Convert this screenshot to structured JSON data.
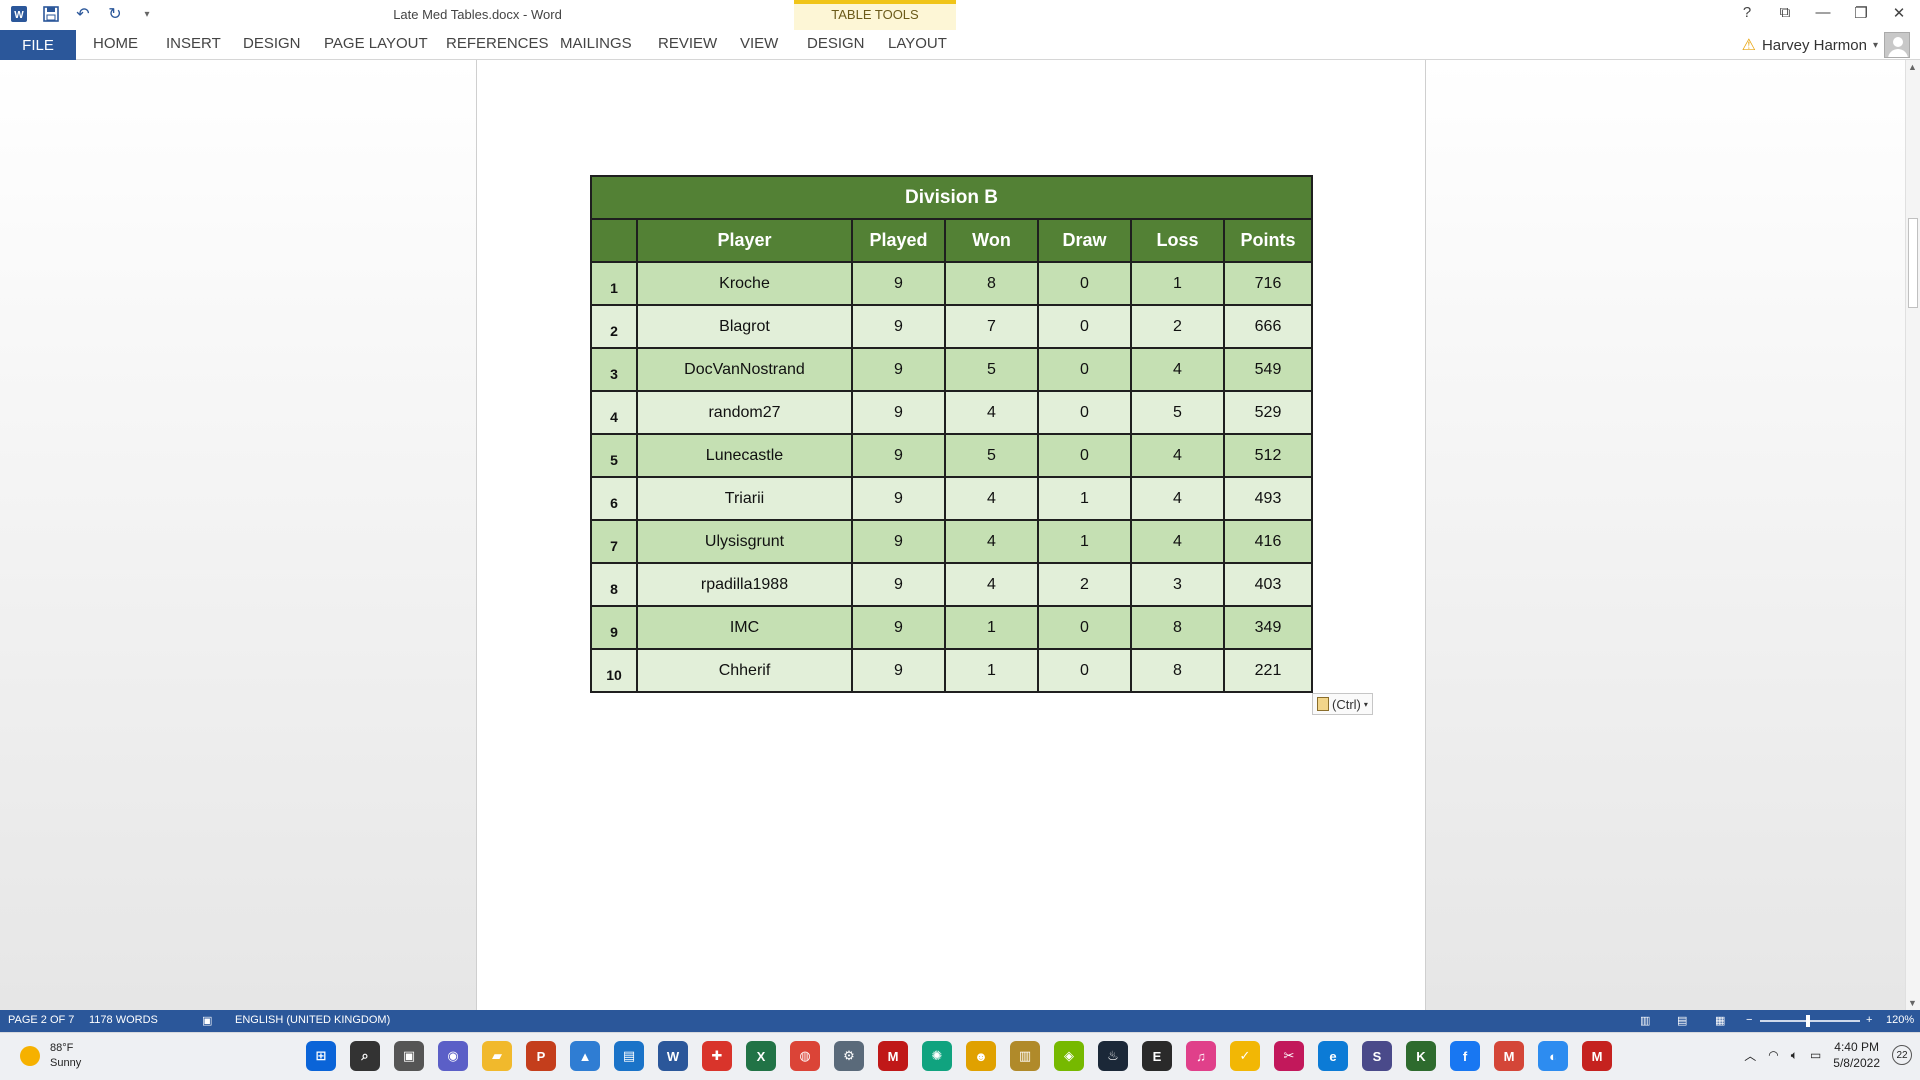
{
  "window": {
    "title": "Late Med Tables.docx - Word",
    "contextual_group": "TABLE TOOLS",
    "controls": [
      "?",
      "⧉",
      "—",
      "❐",
      "✕"
    ]
  },
  "ribbon": {
    "file_label": "FILE",
    "tabs": [
      "HOME",
      "INSERT",
      "DESIGN",
      "PAGE LAYOUT",
      "REFERENCES",
      "MAILINGS",
      "REVIEW",
      "VIEW",
      "DESIGN",
      "LAYOUT"
    ],
    "user_name": "Harvey Harmon"
  },
  "table": {
    "caption": "Division B",
    "headers": [
      "Player",
      "Played",
      "Won",
      "Draw",
      "Loss",
      "Points"
    ],
    "rows": [
      {
        "rank": "1",
        "player": "Kroche",
        "played": "9",
        "won": "8",
        "draw": "0",
        "loss": "1",
        "points": "716"
      },
      {
        "rank": "2",
        "player": "Blagrot",
        "played": "9",
        "won": "7",
        "draw": "0",
        "loss": "2",
        "points": "666"
      },
      {
        "rank": "3",
        "player": "DocVanNostrand",
        "played": "9",
        "won": "5",
        "draw": "0",
        "loss": "4",
        "points": "549"
      },
      {
        "rank": "4",
        "player": "random27",
        "played": "9",
        "won": "4",
        "draw": "0",
        "loss": "5",
        "points": "529"
      },
      {
        "rank": "5",
        "player": "Lunecastle",
        "played": "9",
        "won": "5",
        "draw": "0",
        "loss": "4",
        "points": "512"
      },
      {
        "rank": "6",
        "player": "Triarii",
        "played": "9",
        "won": "4",
        "draw": "1",
        "loss": "4",
        "points": "493"
      },
      {
        "rank": "7",
        "player": "Ulysisgrunt",
        "played": "9",
        "won": "4",
        "draw": "1",
        "loss": "4",
        "points": "416"
      },
      {
        "rank": "8",
        "player": "rpadilla1988",
        "played": "9",
        "won": "4",
        "draw": "2",
        "loss": "3",
        "points": "403"
      },
      {
        "rank": "9",
        "player": "IMC",
        "played": "9",
        "won": "1",
        "draw": "0",
        "loss": "8",
        "points": "349"
      },
      {
        "rank": "10",
        "player": "Chherif",
        "played": "9",
        "won": "1",
        "draw": "0",
        "loss": "8",
        "points": "221"
      }
    ],
    "paste_options_label": "(Ctrl)"
  },
  "statusbar": {
    "page": "PAGE 2 OF 7",
    "words": "1178 WORDS",
    "language": "ENGLISH (UNITED KINGDOM)",
    "zoom": "120%",
    "zoom_minus": "−",
    "zoom_plus": "+"
  },
  "taskbar": {
    "weather_temp": "88°F",
    "weather_desc": "Sunny",
    "time": "4:40 PM",
    "date": "5/8/2022",
    "notifications": "22",
    "app_icons": [
      {
        "name": "start-icon",
        "glyph": "⊞",
        "color": "#0a64d8"
      },
      {
        "name": "search-icon",
        "glyph": "⌕",
        "color": "#333333"
      },
      {
        "name": "task-view-icon",
        "glyph": "▣",
        "color": "#555555"
      },
      {
        "name": "chat-icon",
        "glyph": "◉",
        "color": "#5b5fc7"
      },
      {
        "name": "file-explorer-icon",
        "glyph": "▰",
        "color": "#f1b92c"
      },
      {
        "name": "powerpoint-icon",
        "glyph": "P",
        "color": "#c43e1c"
      },
      {
        "name": "photos-icon",
        "glyph": "▲",
        "color": "#2f7dd3"
      },
      {
        "name": "store-icon",
        "glyph": "▤",
        "color": "#1a73c8"
      },
      {
        "name": "word-icon",
        "glyph": "W",
        "color": "#2b579a"
      },
      {
        "name": "gift-icon",
        "glyph": "✚",
        "color": "#d9342b"
      },
      {
        "name": "excel-icon",
        "glyph": "X",
        "color": "#217346"
      },
      {
        "name": "chrome-icon",
        "glyph": "◍",
        "color": "#db4437"
      },
      {
        "name": "settings-icon",
        "glyph": "⚙",
        "color": "#5a6a7a"
      },
      {
        "name": "mcafee-icon",
        "glyph": "M",
        "color": "#c01818"
      },
      {
        "name": "chatgpt-icon",
        "glyph": "✺",
        "color": "#10a37f"
      },
      {
        "name": "game-icon",
        "glyph": "☻",
        "color": "#e0a100"
      },
      {
        "name": "notes-icon",
        "glyph": "▥",
        "color": "#b08a2a"
      },
      {
        "name": "nvidia-icon",
        "glyph": "◈",
        "color": "#76b900"
      },
      {
        "name": "steam-icon",
        "glyph": "♨",
        "color": "#1b2838"
      },
      {
        "name": "epic-games-icon",
        "glyph": "E",
        "color": "#2a2a2a"
      },
      {
        "name": "itunes-icon",
        "glyph": "♫",
        "color": "#e0408a"
      },
      {
        "name": "norton-icon",
        "glyph": "✓",
        "color": "#f2b705"
      },
      {
        "name": "snip-icon",
        "glyph": "✂",
        "color": "#c2185b"
      },
      {
        "name": "edge-icon",
        "glyph": "e",
        "color": "#0c7bd6"
      },
      {
        "name": "app-s-icon",
        "glyph": "S",
        "color": "#4a4a8a"
      },
      {
        "name": "app-k-icon",
        "glyph": "K",
        "color": "#2e6b2e"
      },
      {
        "name": "facebook-icon",
        "glyph": "f",
        "color": "#1877f2"
      },
      {
        "name": "gmail-icon",
        "glyph": "M",
        "color": "#d44638"
      },
      {
        "name": "bulb-icon",
        "glyph": "◐",
        "color": "#2d8cf0"
      },
      {
        "name": "gmail-2-icon",
        "glyph": "M",
        "color": "#c5221f"
      }
    ]
  }
}
